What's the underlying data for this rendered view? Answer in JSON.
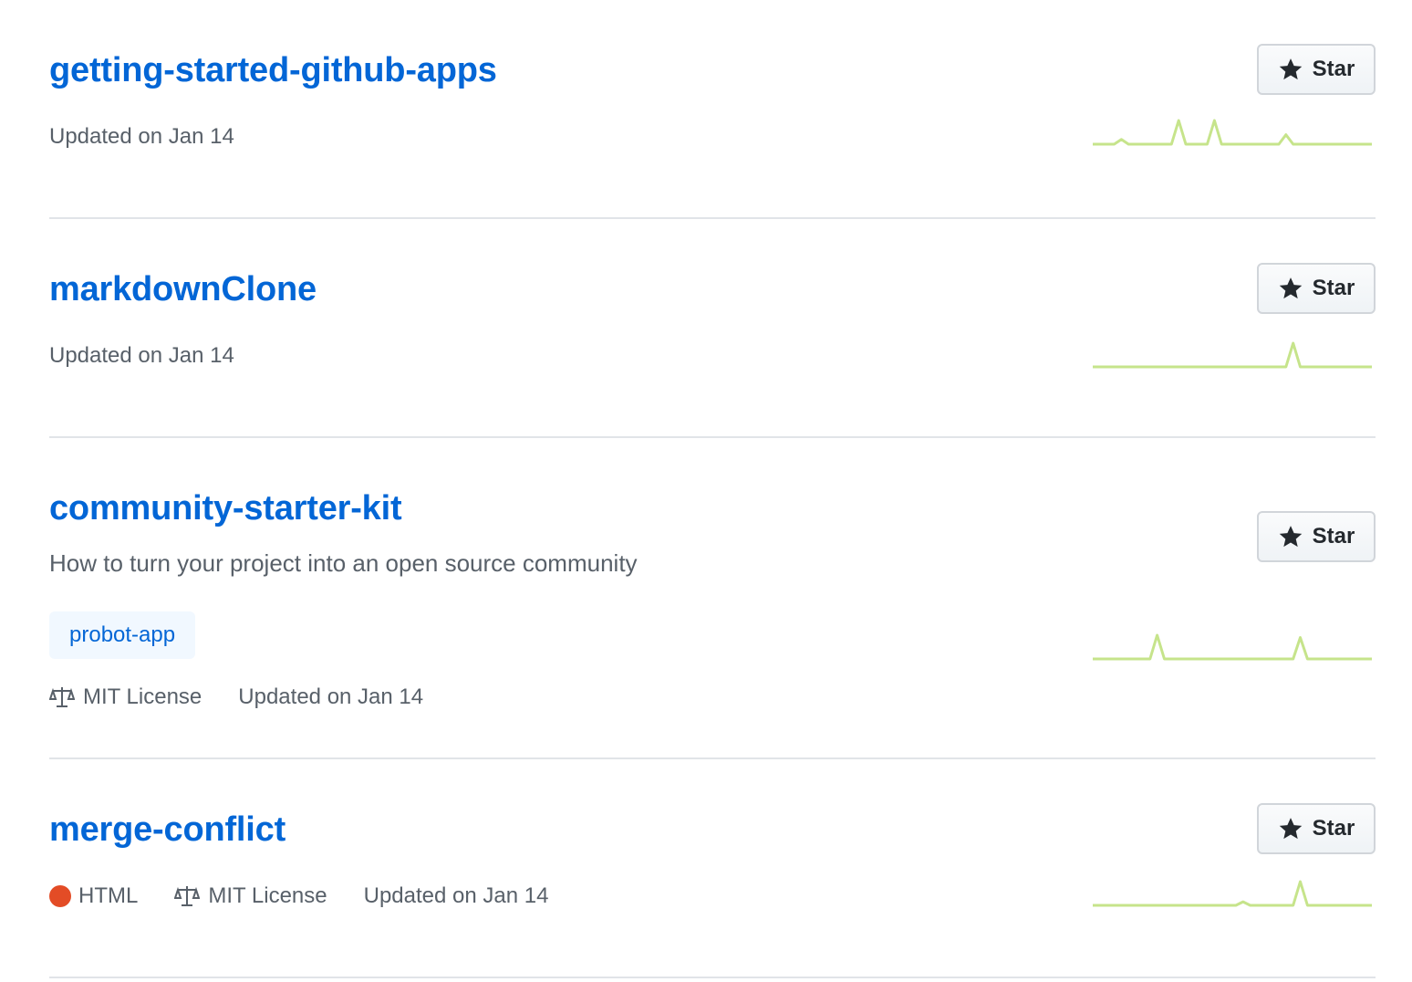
{
  "repos": [
    {
      "name": "getting-started-github-apps",
      "updated": "Updated on Jan 14",
      "star_label": "Star",
      "activity": [
        0,
        0,
        0,
        0,
        0.2,
        0,
        0,
        0,
        0,
        0,
        0,
        0,
        1,
        0,
        0,
        0,
        0,
        1,
        0,
        0,
        0,
        0,
        0,
        0,
        0,
        0,
        0,
        0.4,
        0,
        0,
        0,
        0,
        0,
        0,
        0,
        0,
        0,
        0,
        0,
        0
      ]
    },
    {
      "name": "markdownClone",
      "updated": "Updated on Jan 14",
      "star_label": "Star",
      "activity": [
        0,
        0,
        0,
        0,
        0,
        0,
        0,
        0,
        0,
        0,
        0,
        0,
        0,
        0,
        0,
        0,
        0,
        0,
        0,
        0,
        0,
        0,
        0,
        0,
        0,
        0,
        0,
        0,
        1,
        0,
        0,
        0,
        0,
        0,
        0,
        0,
        0,
        0,
        0,
        0
      ]
    },
    {
      "name": "community-starter-kit",
      "description": "How to turn your project into an open source community",
      "topic": "probot-app",
      "license": "MIT License",
      "updated": "Updated on Jan 14",
      "star_label": "Star",
      "activity": [
        0,
        0,
        0,
        0,
        0,
        0,
        0,
        0,
        0,
        1,
        0,
        0,
        0,
        0,
        0,
        0,
        0,
        0,
        0,
        0,
        0,
        0,
        0,
        0,
        0,
        0,
        0,
        0,
        0,
        0.9,
        0,
        0,
        0,
        0,
        0,
        0,
        0,
        0,
        0,
        0
      ]
    },
    {
      "name": "merge-conflict",
      "language": "HTML",
      "language_color": "#e34c26",
      "license": "MIT License",
      "updated": "Updated on Jan 14",
      "star_label": "Star",
      "activity": [
        0,
        0,
        0,
        0,
        0,
        0,
        0,
        0,
        0,
        0,
        0,
        0,
        0,
        0,
        0,
        0,
        0,
        0,
        0,
        0,
        0,
        0.15,
        0,
        0,
        0,
        0,
        0,
        0,
        0,
        1,
        0,
        0,
        0,
        0,
        0,
        0,
        0,
        0,
        0,
        0
      ]
    }
  ],
  "colors": {
    "spark": "#c6e48b",
    "link": "#0366d6"
  },
  "icons": {
    "star": "star-icon",
    "license": "law-icon"
  }
}
